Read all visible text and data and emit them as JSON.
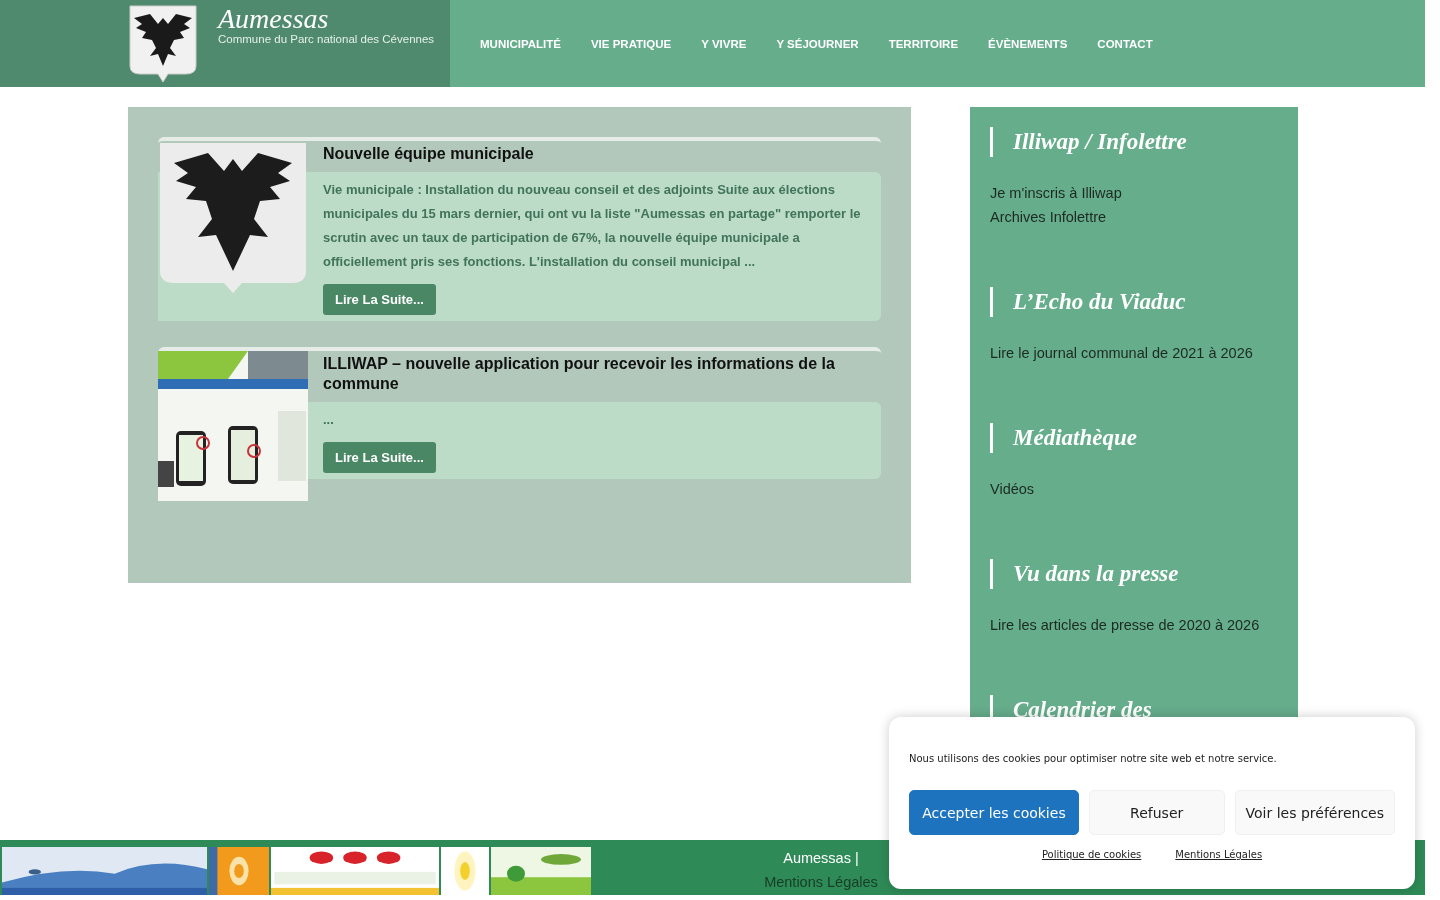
{
  "header": {
    "site_title": "Aumessas",
    "tagline": "Commune du Parc national des Cévennes",
    "nav": [
      {
        "label": "MUNICIPALITÉ"
      },
      {
        "label": "VIE PRATIQUE"
      },
      {
        "label": "Y VIVRE"
      },
      {
        "label": "Y SÉJOURNER"
      },
      {
        "label": "TERRITOIRE"
      },
      {
        "label": "ÉVÈNEMENTS"
      },
      {
        "label": "CONTACT"
      }
    ]
  },
  "articles": [
    {
      "image": {
        "kind": "emblem"
      },
      "title": "Nouvelle équipe municipale",
      "excerpt": "Vie municipale : Installation du nouveau conseil et des adjoints Suite aux élections municipales du 15 mars dernier, qui ont vu la liste \"Aumessas en partage\" remporter le scrutin avec un taux de participation de 67%, la nouvelle équipe municipale a officiellement pris ses fonctions. L'installation du conseil municipal ...",
      "button": "Lire La Suite..."
    },
    {
      "title": "ILLIWAP – nouvelle application pour recevoir les informations de la commune",
      "excerpt": "...",
      "button": "Lire La Suite..."
    }
  ],
  "sidebar": [
    {
      "title": "Illiwap / Infolettre",
      "links": [
        "Je m'inscris à Illiwap",
        "Archives Infolettre"
      ]
    },
    {
      "title": "L’Echo du Viaduc",
      "links": [
        "Lire le journal communal de 2021 à 2026"
      ]
    },
    {
      "title": "Médiathèque",
      "links": [
        "Vidéos"
      ]
    },
    {
      "title": "Vu dans la presse",
      "links": [
        "Lire les articles de presse de 2020 à 2026"
      ]
    },
    {
      "title": "Calendrier des"
    }
  ],
  "footer": {
    "site_link": "Aumessas",
    "separator": "|",
    "legal_link": "Mentions Légales"
  },
  "cookie_banner": {
    "message": "Nous utilisons des cookies pour optimiser notre site web et notre service.",
    "buttons": [
      {
        "label": "Accepter les cookies",
        "kind": "primary"
      },
      {
        "label": "Refuser",
        "kind": "secondary"
      },
      {
        "label": "Voir les préférences",
        "kind": "secondary"
      }
    ],
    "links": [
      "Politique de cookies",
      "Mentions Légales"
    ]
  }
}
